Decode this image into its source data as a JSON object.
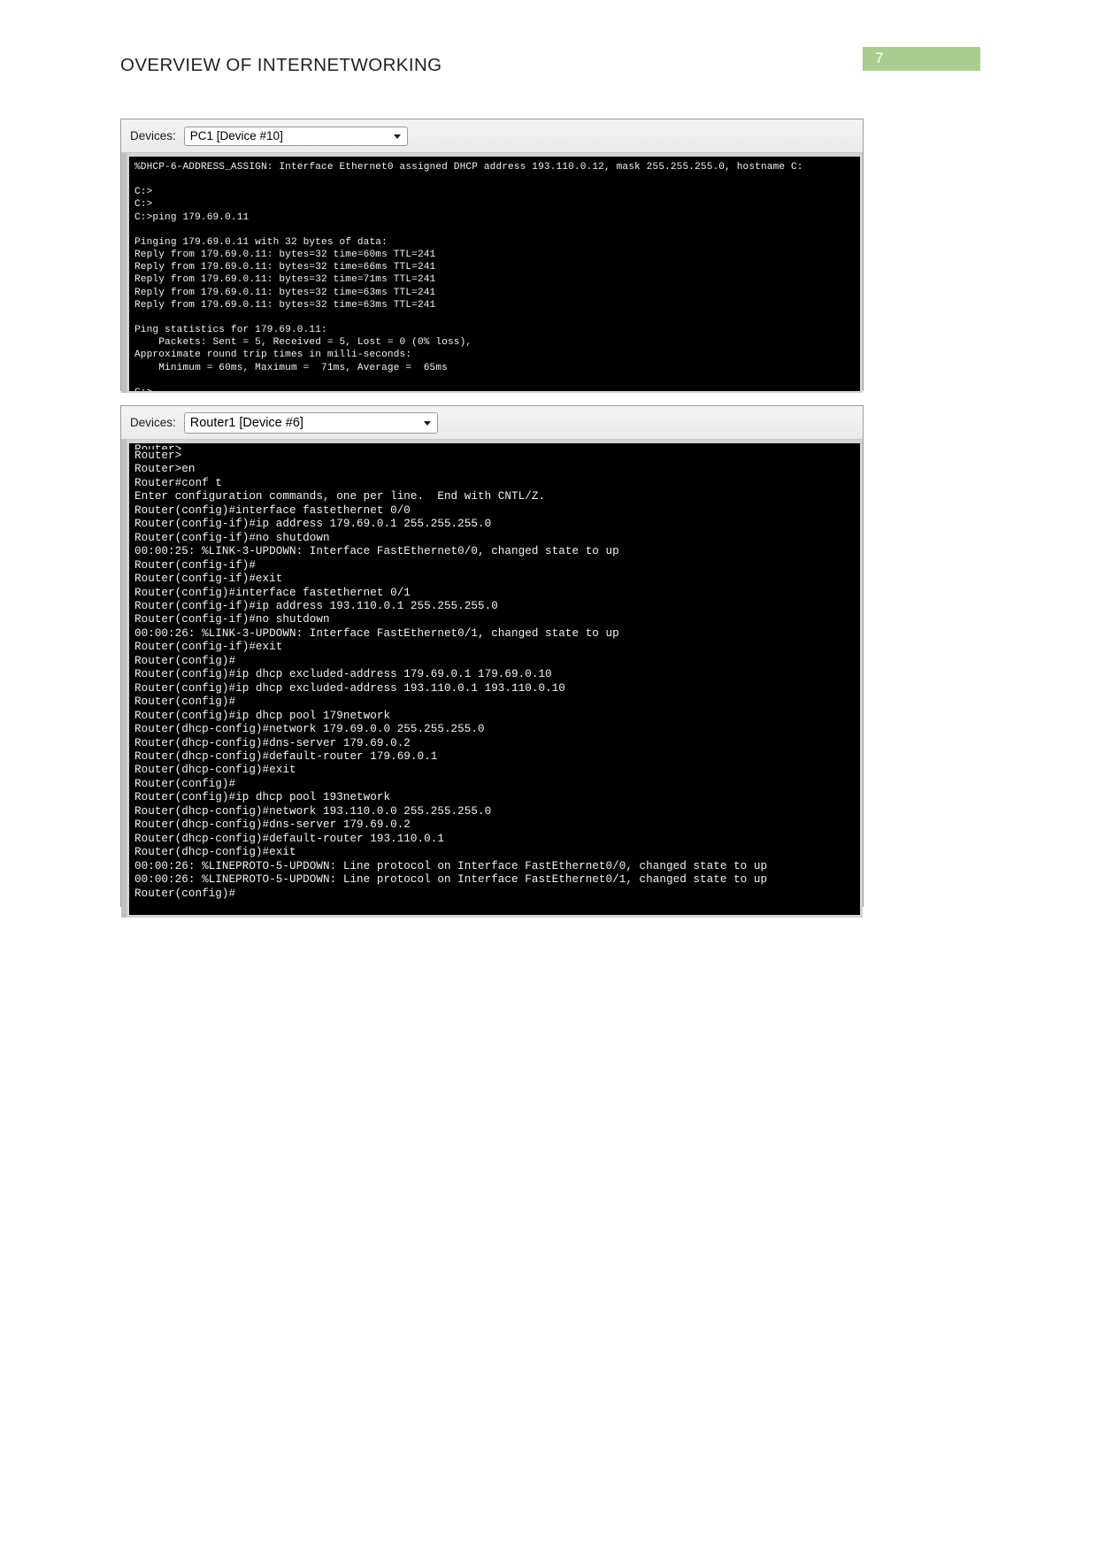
{
  "page": {
    "title": "OVERVIEW OF INTERNETWORKING",
    "number": "7",
    "badge_color": "#a9cd8f"
  },
  "windows": [
    {
      "id": "pc-console",
      "device_label": "Devices:",
      "device_selected": "PC1 [Device #10]",
      "caret_icon": "chevron-down-icon",
      "terminal_lines": [
        "%DHCP-6-ADDRESS_ASSIGN: Interface Ethernet0 assigned DHCP address 193.110.0.12, mask 255.255.255.0, hostname C:",
        "",
        "C:>",
        "C:>",
        "C:>ping 179.69.0.11",
        "",
        "Pinging 179.69.0.11 with 32 bytes of data:",
        "Reply from 179.69.0.11: bytes=32 time=60ms TTL=241",
        "Reply from 179.69.0.11: bytes=32 time=66ms TTL=241",
        "Reply from 179.69.0.11: bytes=32 time=71ms TTL=241",
        "Reply from 179.69.0.11: bytes=32 time=63ms TTL=241",
        "Reply from 179.69.0.11: bytes=32 time=63ms TTL=241",
        "",
        "Ping statistics for 179.69.0.11:",
        "    Packets: Sent = 5, Received = 5, Lost = 0 (0% loss),",
        "Approximate round trip times in milli-seconds:",
        "    Minimum = 60ms, Maximum =  71ms, Average =  65ms",
        "",
        "C:>"
      ]
    },
    {
      "id": "router-console",
      "device_label": "Devices:",
      "device_selected": "Router1 [Device #6]",
      "caret_icon": "chevron-down-icon",
      "terminal_lines": [
        "Router>",
        "Router>",
        "Router>en",
        "Router#conf t",
        "Enter configuration commands, one per line.  End with CNTL/Z.",
        "Router(config)#interface fastethernet 0/0",
        "Router(config-if)#ip address 179.69.0.1 255.255.255.0",
        "Router(config-if)#no shutdown",
        "00:00:25: %LINK-3-UPDOWN: Interface FastEthernet0/0, changed state to up",
        "Router(config-if)#",
        "Router(config-if)#exit",
        "Router(config)#interface fastethernet 0/1",
        "Router(config-if)#ip address 193.110.0.1 255.255.255.0",
        "Router(config-if)#no shutdown",
        "00:00:26: %LINK-3-UPDOWN: Interface FastEthernet0/1, changed state to up",
        "Router(config-if)#exit",
        "Router(config)#",
        "Router(config)#ip dhcp excluded-address 179.69.0.1 179.69.0.10",
        "Router(config)#ip dhcp excluded-address 193.110.0.1 193.110.0.10",
        "Router(config)#",
        "Router(config)#ip dhcp pool 179network",
        "Router(dhcp-config)#network 179.69.0.0 255.255.255.0",
        "Router(dhcp-config)#dns-server 179.69.0.2",
        "Router(dhcp-config)#default-router 179.69.0.1",
        "Router(dhcp-config)#exit",
        "Router(config)#",
        "Router(config)#ip dhcp pool 193network",
        "Router(dhcp-config)#network 193.110.0.0 255.255.255.0",
        "Router(dhcp-config)#dns-server 179.69.0.2",
        "Router(dhcp-config)#default-router 193.110.0.1",
        "Router(dhcp-config)#exit",
        "00:00:26: %LINEPROTO-5-UPDOWN: Line protocol on Interface FastEthernet0/0, changed state to up",
        "00:00:26: %LINEPROTO-5-UPDOWN: Line protocol on Interface FastEthernet0/1, changed state to up",
        "Router(config)#"
      ]
    }
  ]
}
